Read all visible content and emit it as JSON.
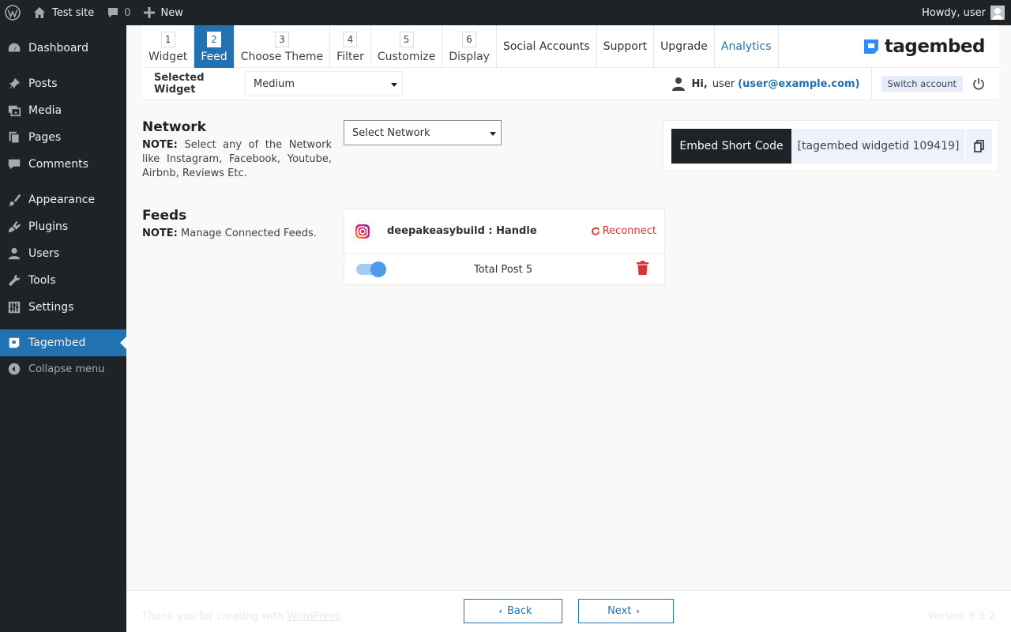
{
  "adminbar": {
    "site_name": "Test site",
    "comments_count": "0",
    "new_label": "New",
    "howdy": "Howdy, user"
  },
  "sidebar": {
    "items": [
      {
        "label": "Dashboard",
        "icon": "dashboard-icon"
      },
      {
        "label": "Posts",
        "icon": "pin-icon"
      },
      {
        "label": "Media",
        "icon": "media-icon"
      },
      {
        "label": "Pages",
        "icon": "pages-icon"
      },
      {
        "label": "Comments",
        "icon": "comment-icon"
      },
      {
        "label": "Appearance",
        "icon": "brush-icon"
      },
      {
        "label": "Plugins",
        "icon": "plug-icon"
      },
      {
        "label": "Users",
        "icon": "user-icon"
      },
      {
        "label": "Tools",
        "icon": "wrench-icon"
      },
      {
        "label": "Settings",
        "icon": "sliders-icon"
      },
      {
        "label": "Tagembed",
        "icon": "tagembed-icon",
        "active": true
      }
    ],
    "collapse_label": "Collapse menu"
  },
  "steps": [
    {
      "num": "1",
      "label": "Widget"
    },
    {
      "num": "2",
      "label": "Feed",
      "active": true
    },
    {
      "num": "3",
      "label": "Choose Theme"
    },
    {
      "num": "4",
      "label": "Filter"
    },
    {
      "num": "5",
      "label": "Customize"
    },
    {
      "num": "6",
      "label": "Display"
    }
  ],
  "tabs": [
    "Social Accounts",
    "Support",
    "Upgrade",
    "Analytics"
  ],
  "logo_text": "tagembed",
  "widget_bar": {
    "label": "Selected Widget",
    "selected": "Medium",
    "hi": "Hi,",
    "user": "user",
    "email": "(user@example.com)",
    "switch_label": "Switch account"
  },
  "network": {
    "title": "Network",
    "note_strong": "NOTE:",
    "note": "Select any of the Network like Instagram, Facebook, Youtube, Airbnb, Reviews Etc.",
    "select_placeholder": "Select Network"
  },
  "embed": {
    "label": "Embed Short Code",
    "code": "[tagembed widgetid 109419]"
  },
  "feeds": {
    "title": "Feeds",
    "note_strong": "NOTE:",
    "note": "Manage Connected Feeds.",
    "item": {
      "name": "deepakeasybuild : Handle",
      "reconnect": "Reconnect",
      "total_label": "Total Post",
      "total_count": "5",
      "enabled": true
    }
  },
  "footer": {
    "thanks": "Thank you for creating with",
    "wordpress": "WordPress",
    "period": ".",
    "version": "Version 6.5.2",
    "back": "Back",
    "next": "Next"
  },
  "colors": {
    "admin_dark": "#1d2327",
    "accent": "#2271b1",
    "danger": "#d63638"
  }
}
